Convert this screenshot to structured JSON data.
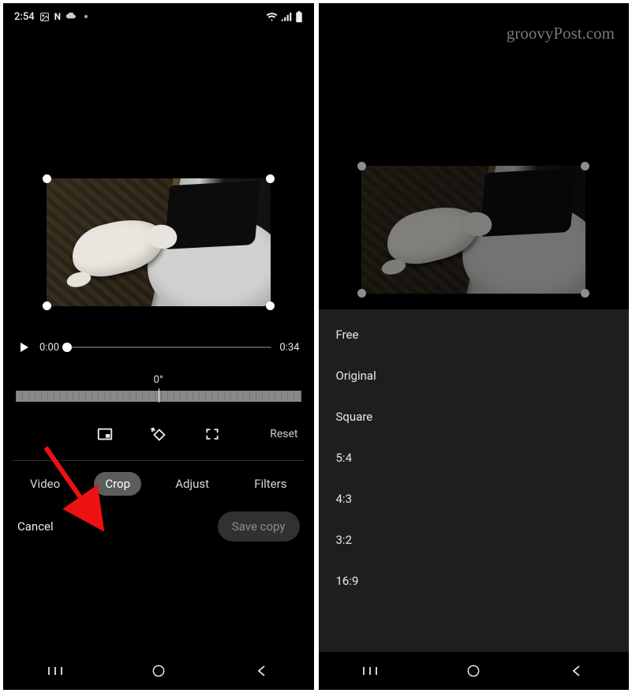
{
  "watermark": "groovyPost.com",
  "left": {
    "status": {
      "time": "2:54",
      "n": "N"
    },
    "timeline": {
      "current": "0:00",
      "duration": "0:34"
    },
    "angle": "0°",
    "reset": "Reset",
    "tabs": {
      "video": "Video",
      "crop": "Crop",
      "adjust": "Adjust",
      "filters": "Filters"
    },
    "actions": {
      "cancel": "Cancel",
      "save": "Save copy"
    }
  },
  "right": {
    "ratios": [
      "Free",
      "Original",
      "Square",
      "5:4",
      "4:3",
      "3:2",
      "16:9"
    ]
  }
}
